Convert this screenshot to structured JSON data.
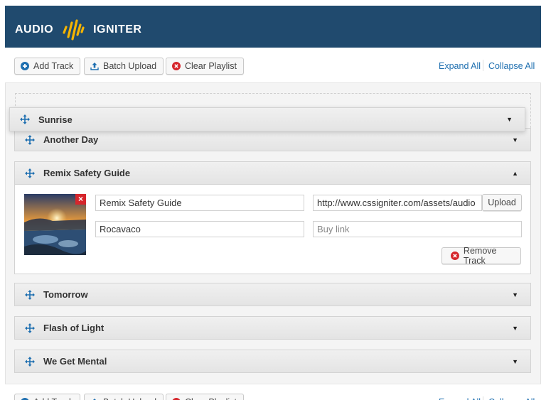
{
  "header": {
    "logo_left": "AUDIO",
    "logo_right": "IGNITER",
    "logo_color": "#f5b400",
    "bg_color": "#204a6e"
  },
  "toolbar": {
    "add_track": "Add Track",
    "batch_upload": "Batch Upload",
    "clear_playlist": "Clear Playlist",
    "expand_all": "Expand All",
    "collapse_all": "Collapse All"
  },
  "tracks": {
    "dragging": {
      "title": "Sunrise"
    },
    "t1": {
      "title": "Another Day"
    },
    "t2": {
      "title": "Remix Safety Guide"
    },
    "t3": {
      "title": "Tomorrow"
    },
    "t4": {
      "title": "Flash of Light"
    },
    "t5": {
      "title": "We Get Mental"
    }
  },
  "expanded": {
    "title_value": "Remix Safety Guide",
    "url_value": "http://www.cssigniter.com/assets/audio",
    "artist_value": "Rocavaco",
    "buy_link_placeholder": "Buy link",
    "upload_label": "Upload",
    "remove_label": "Remove Track"
  },
  "icons": {
    "move": "move-arrows-icon",
    "collapsed": "▼",
    "expanded": "▲"
  }
}
